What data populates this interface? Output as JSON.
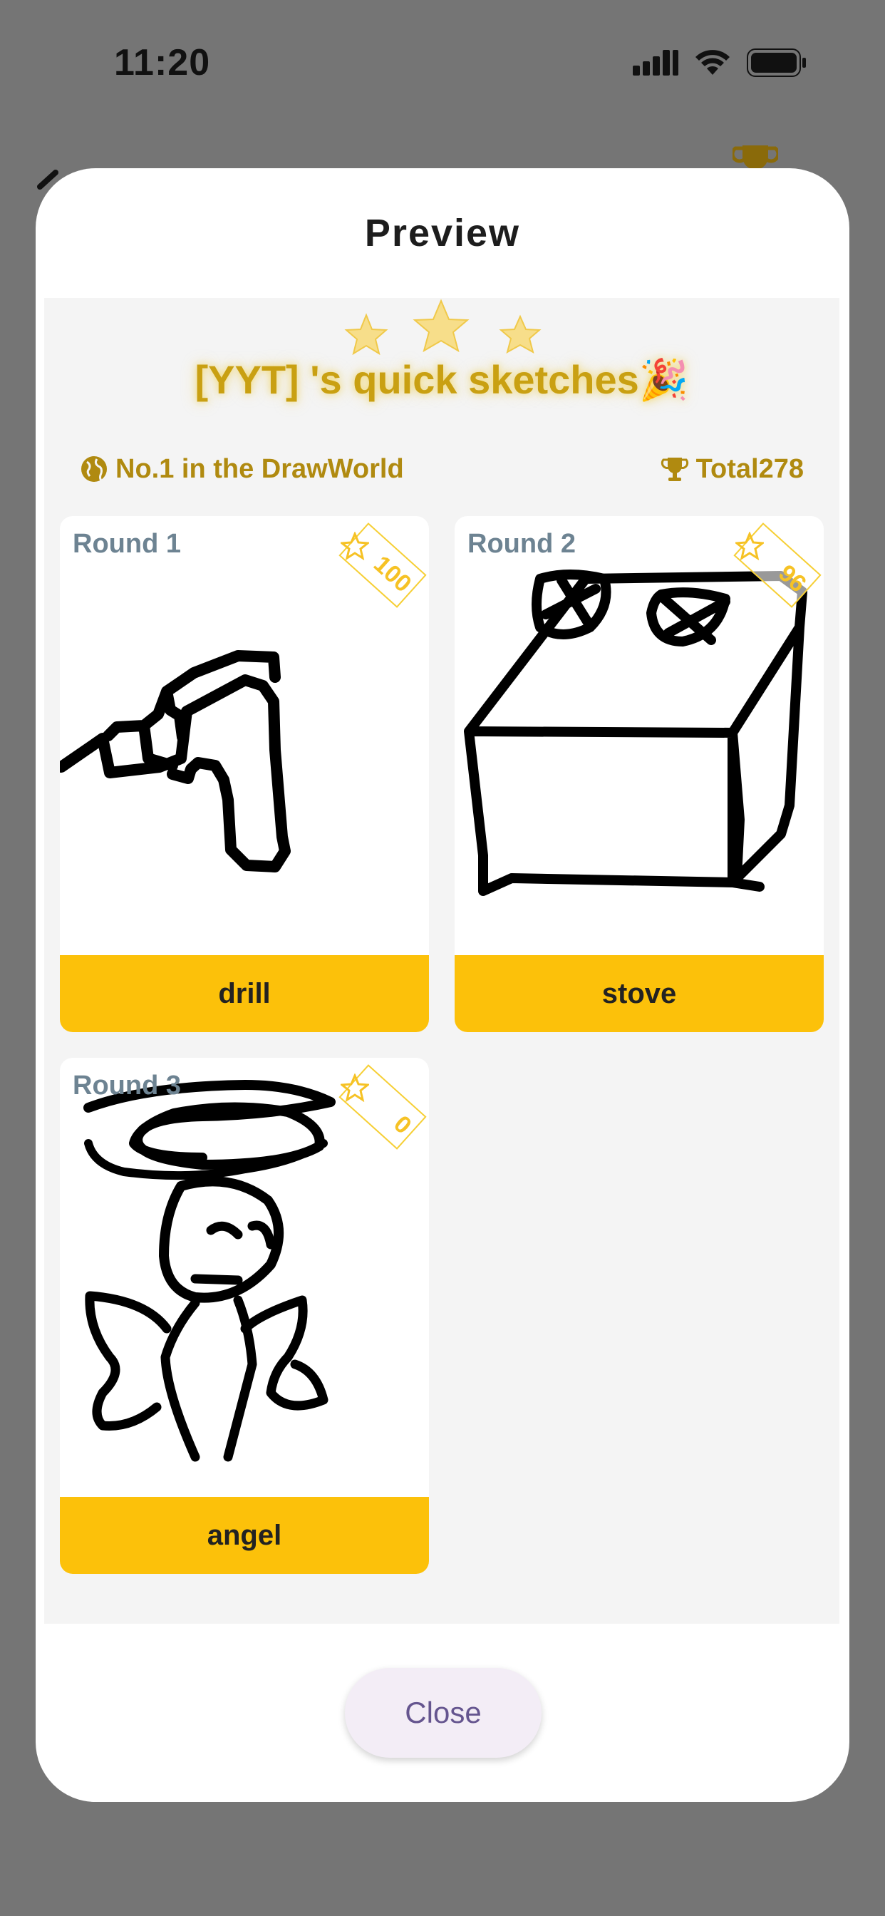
{
  "status_bar": {
    "time": "11:20"
  },
  "modal": {
    "title": "Preview",
    "headline": "[YYT] 's quick sketches🎉",
    "rank_text": "No.1 in the DrawWorld",
    "total_text": "Total278",
    "cards": [
      {
        "round": "Round 1",
        "score": "100",
        "word": "drill"
      },
      {
        "round": "Round 2",
        "score": "96",
        "word": "stove"
      },
      {
        "round": "Round 3",
        "score": "0",
        "word": "angel"
      }
    ],
    "close_label": "Close"
  },
  "colors": {
    "overlay": "#757575",
    "accent_yellow": "#fcc10a",
    "gold_text": "#c9a012",
    "round_label": "#6d8392",
    "close_text": "#65558f"
  }
}
